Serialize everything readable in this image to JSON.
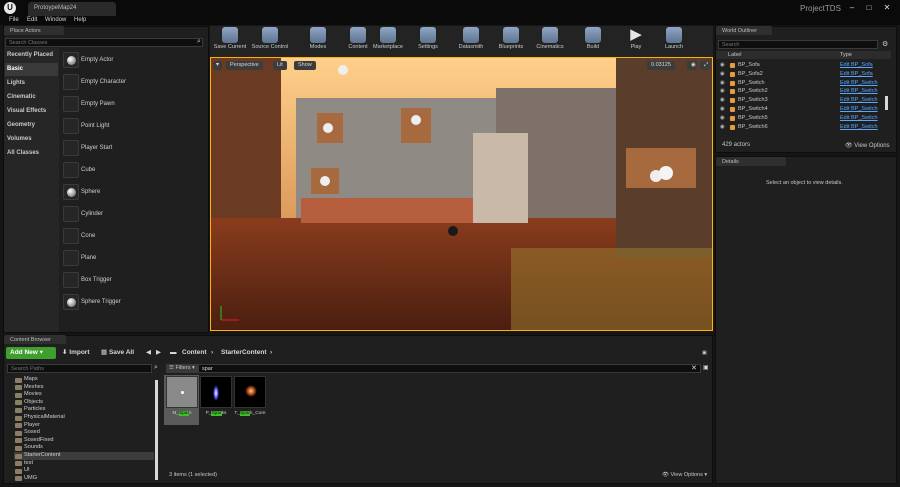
{
  "window": {
    "tab_title": "ProtoypeMap24",
    "project_name": "ProjectTDS",
    "logo_letter": "U"
  },
  "menu": [
    "File",
    "Edit",
    "Window",
    "Help"
  ],
  "place_actors": {
    "title": "Place Actors",
    "search_placeholder": "Search Classes",
    "categories": [
      "Recently Placed",
      "Basic",
      "Lights",
      "Cinematic",
      "Visual Effects",
      "Geometry",
      "Volumes",
      "All Classes"
    ],
    "selected_category": "Basic",
    "actors": [
      "Empty Actor",
      "Empty Character",
      "Empty Pawn",
      "Point Light",
      "Player Start",
      "Cube",
      "Sphere",
      "Cylinder",
      "Cone",
      "Plane",
      "Box Trigger",
      "Sphere Trigger"
    ]
  },
  "toolbar": [
    "Save Current",
    "Source Control",
    "Modes",
    "Content",
    "Marketplace",
    "Settings",
    "Datasmith",
    "Blueprints",
    "Cinematics",
    "Build",
    "Play",
    "Launch"
  ],
  "viewport": {
    "perspective": "Perspective",
    "lit": "Lit",
    "show": "Show",
    "grid_value": "0.03125"
  },
  "outliner": {
    "title": "World Outliner",
    "search_placeholder": "Search",
    "col_label": "Label",
    "col_type": "Type",
    "rows": [
      {
        "label": "BP_Sofa",
        "type": "Edit BP_Sofa"
      },
      {
        "label": "BP_Sofa2",
        "type": "Edit BP_Sofa"
      },
      {
        "label": "BP_Switch",
        "type": "Edit BP_Switch"
      },
      {
        "label": "BP_Switch2",
        "type": "Edit BP_Switch"
      },
      {
        "label": "BP_Switch3",
        "type": "Edit BP_Switch"
      },
      {
        "label": "BP_Switch4",
        "type": "Edit BP_Switch"
      },
      {
        "label": "BP_Switch5",
        "type": "Edit BP_Switch"
      },
      {
        "label": "BP_Switch6",
        "type": "Edit BP_Switch"
      }
    ],
    "count": "429 actors",
    "view_options": "View Options"
  },
  "details": {
    "title": "Details",
    "empty_msg": "Select an object to view details."
  },
  "content_browser": {
    "title": "Content Browser",
    "add_new": "Add New",
    "import": "Import",
    "save_all": "Save All",
    "path": [
      "Content",
      "StarterContent"
    ],
    "search_paths": "Search Paths",
    "filters": "Filters",
    "filter_text": "spar",
    "folders": [
      "Maps",
      "Meshes",
      "Movies",
      "Objects",
      "Particles",
      "PhysicalMaterial",
      "Player",
      "Sosed",
      "SosedFixed",
      "Sounds",
      "StarterContent",
      "test",
      "UI",
      "UMG"
    ],
    "selected_folder": "StarterContent",
    "assets": [
      {
        "prefix": "M_",
        "highlight": "Spar",
        "suffix": "k"
      },
      {
        "prefix": "P_",
        "highlight": "Spar",
        "suffix": "ks"
      },
      {
        "prefix": "T_",
        "highlight": "Spar",
        "suffix": "k_Core"
      }
    ],
    "status": "3 items (1 selected)",
    "view_options": "View Options"
  }
}
